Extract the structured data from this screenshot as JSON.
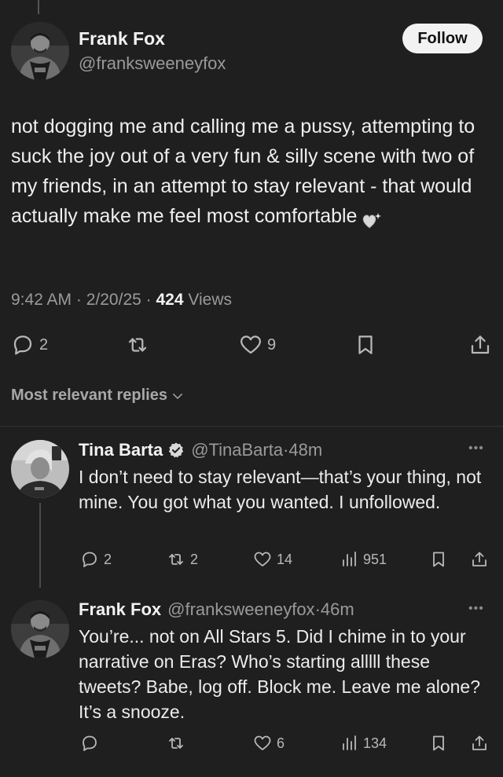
{
  "tweet": {
    "author_name": "Frank Fox",
    "author_handle": "@franksweeneyfox",
    "follow_label": "Follow",
    "text": "not dogging me and calling me a pussy, attempting to suck the joy out of a very fun & silly scene with two of my friends, in an attempt to stay relevant - that would actually make me feel most comfortable",
    "emoji_icon": "white-heart-sparkle-icon",
    "time": "9:42 AM",
    "date": "2/20/25",
    "views_count": "424",
    "views_label": "Views",
    "reply_count": "2",
    "like_count": "9"
  },
  "sort_label": "Most relevant replies",
  "replies": [
    {
      "name": "Tina Barta",
      "verified": true,
      "handle": "@TinaBarta",
      "time": "48m",
      "text": "I don’t need to stay relevant—that’s your thing, not mine. You got what you wanted. I unfollowed.",
      "replies": "2",
      "reposts": "2",
      "likes": "14",
      "views": "951"
    },
    {
      "name": "Frank Fox",
      "handle": "@franksweeneyfox",
      "time": "46m",
      "text": "You’re... not on All Stars 5. Did I chime in to your narrative on Eras? Who’s starting alllll these tweets? Babe, log off. Block me. Leave me alone? It’s a snooze.",
      "likes": "6",
      "views": "134"
    }
  ],
  "colors": {
    "background": "#1f1f1f",
    "verified_badge": "#d9d9d9",
    "muted_text": "#9a9a9a"
  }
}
